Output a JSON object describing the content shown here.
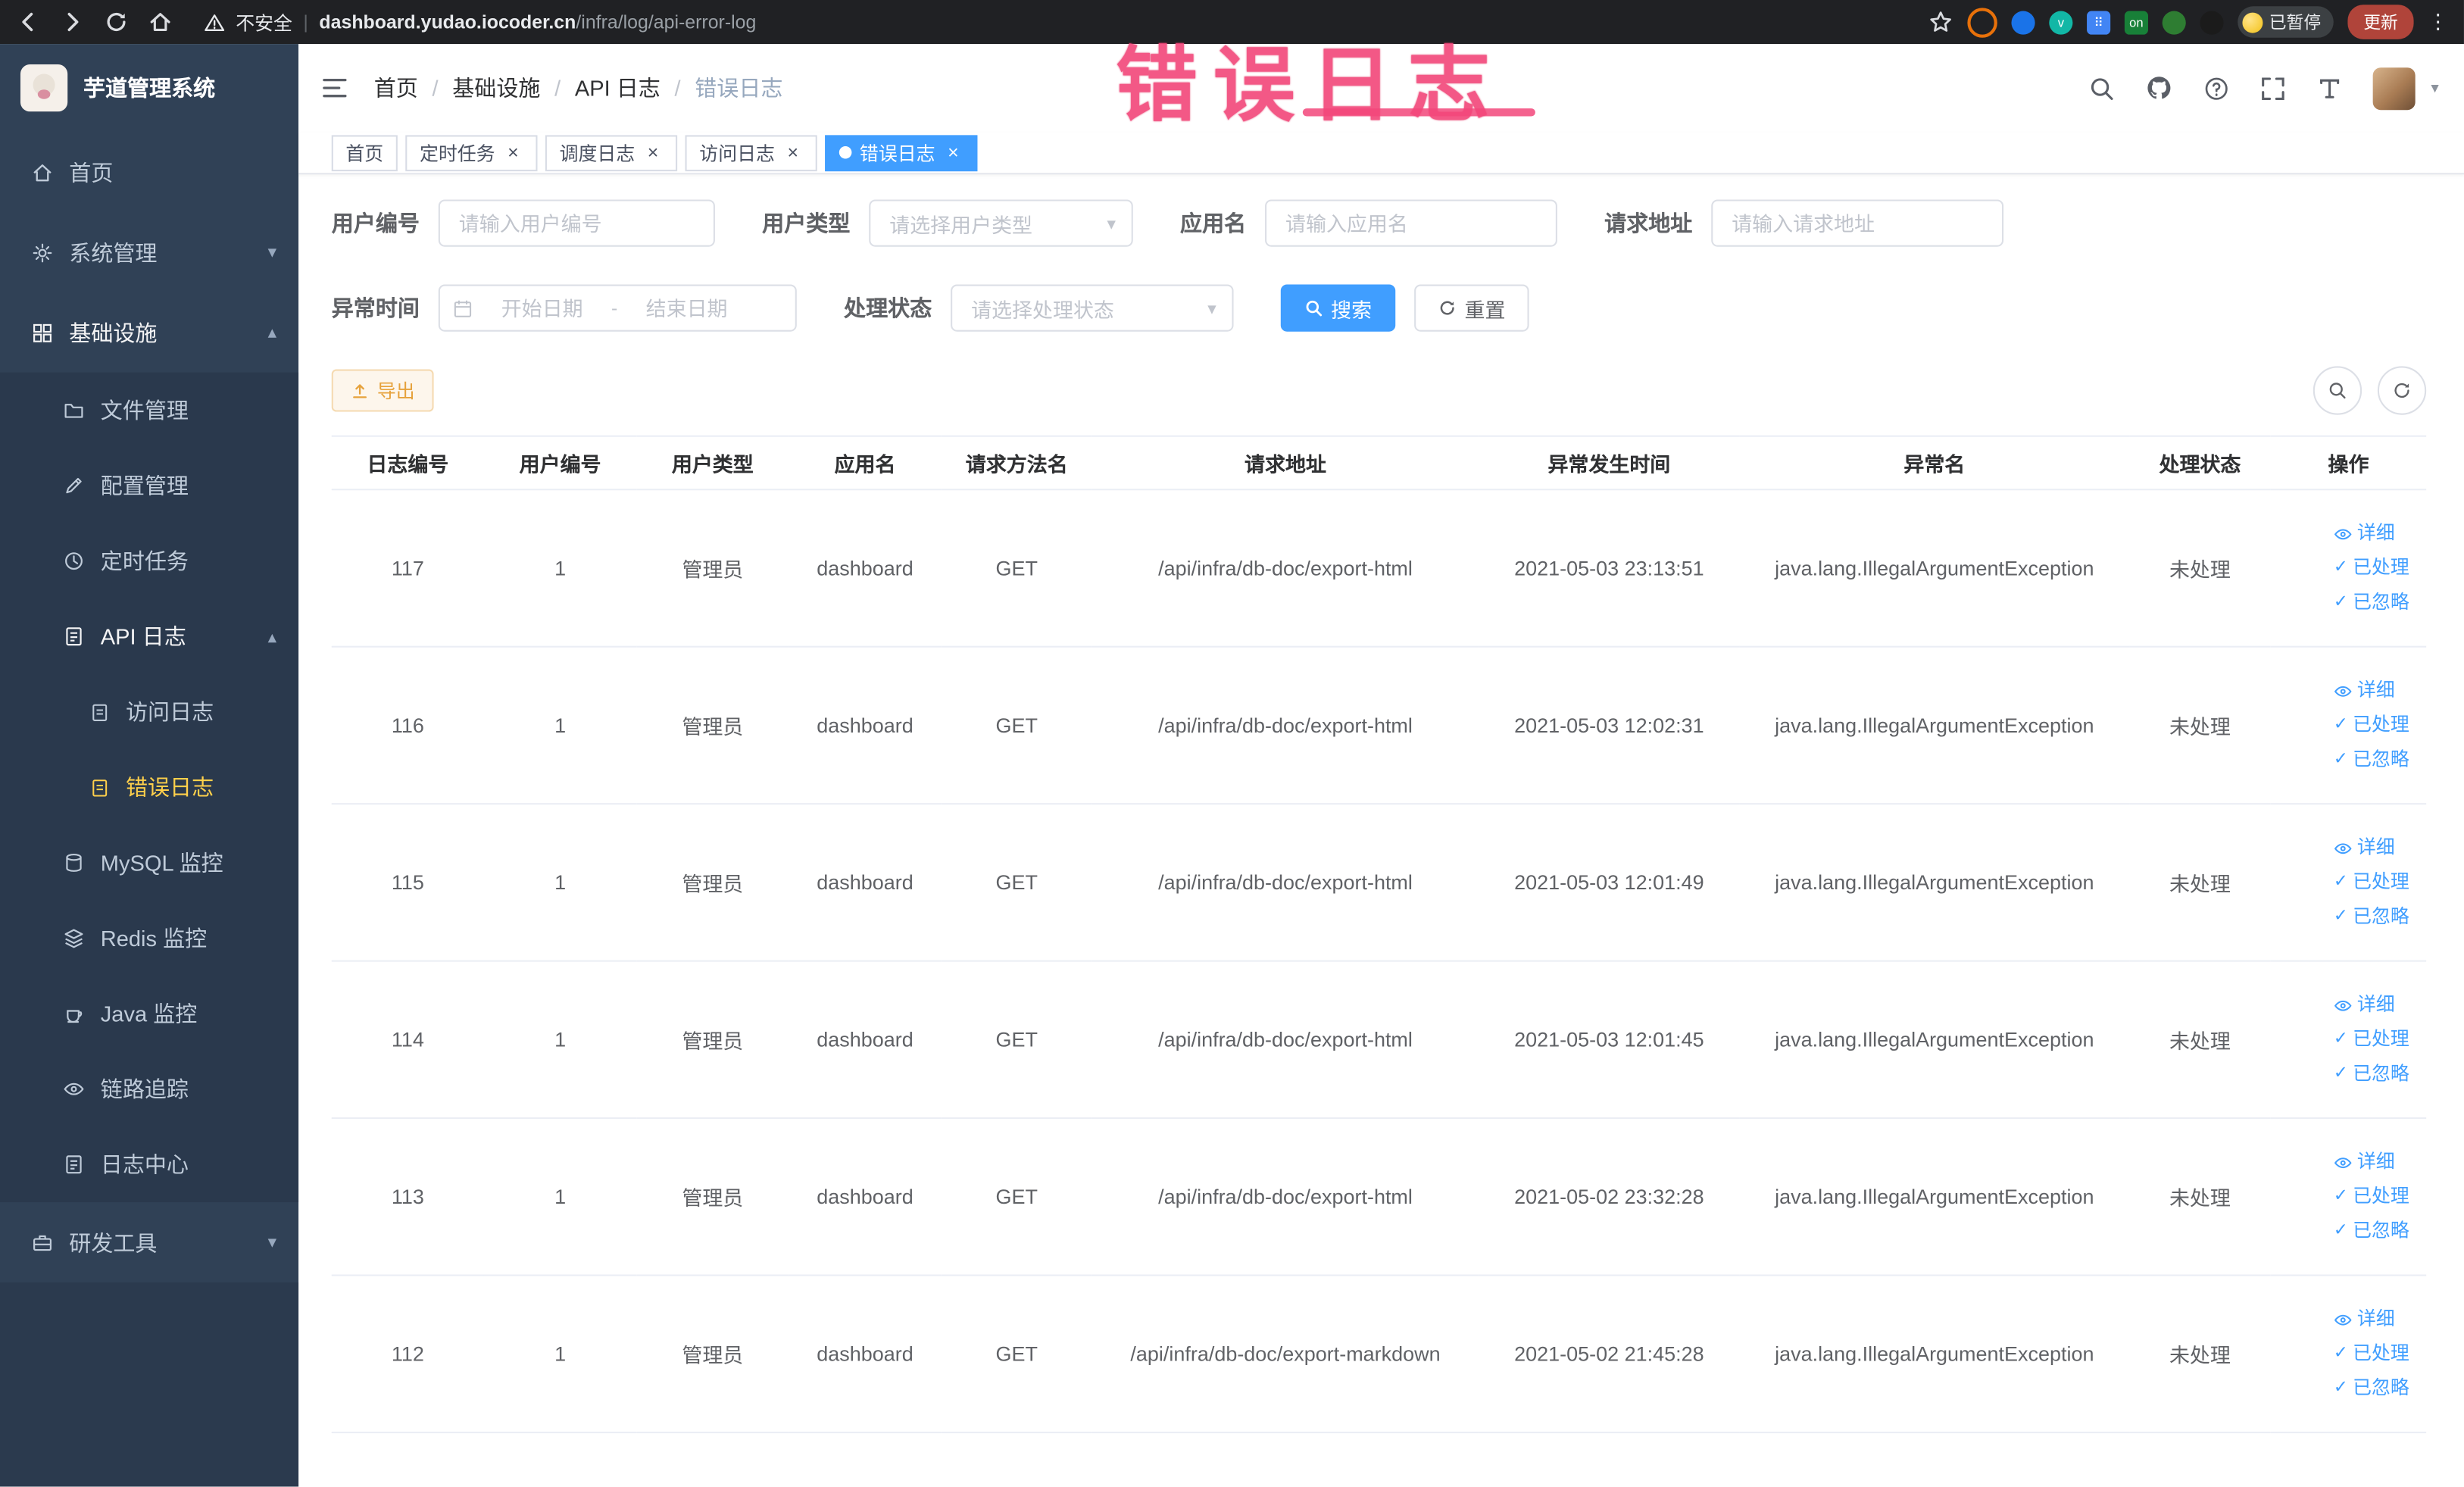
{
  "colors": {
    "primary": "#409eff",
    "sidebar_bg": "#304156",
    "active_menu_text": "#ffd04b",
    "warning": "#e6a23c",
    "annotation_pink": "#f2477a",
    "link_blue": "#409eff"
  },
  "icons": {
    "close": "×",
    "check": "✓",
    "kebab": "⋮",
    "caret_down": "▾",
    "caret_up": "▴",
    "question": "?",
    "breadcrumb_sep": "/",
    "range_sep": "-"
  },
  "browser": {
    "security_label": "不安全",
    "url_domain": "dashboard.yudao.iocoder.cn",
    "url_path": "/infra/log/api-error-log",
    "extension_on_label": "on",
    "paused_label": "已暂停",
    "update_label": "更新"
  },
  "sidebar": {
    "title": "芋道管理系统",
    "items": {
      "home": "首页",
      "system": "系统管理",
      "infra": "基础设施",
      "file": "文件管理",
      "config": "配置管理",
      "job": "定时任务",
      "api_log": "API 日志",
      "access_log": "访问日志",
      "error_log": "错误日志",
      "mysql": "MySQL 监控",
      "redis": "Redis 监控",
      "java": "Java 监控",
      "trace": "链路追踪",
      "log_center": "日志中心",
      "dev_tools": "研发工具"
    }
  },
  "navbar": {
    "breadcrumbs": [
      "首页",
      "基础设施",
      "API 日志",
      "错误日志"
    ]
  },
  "annotation": {
    "text": "错误日志"
  },
  "tabs": [
    {
      "label": "首页"
    },
    {
      "label": "定时任务"
    },
    {
      "label": "调度日志"
    },
    {
      "label": "访问日志"
    },
    {
      "label": "错误日志"
    }
  ],
  "filters": {
    "user_id_label": "用户编号",
    "user_id_placeholder": "请输入用户编号",
    "user_type_label": "用户类型",
    "user_type_placeholder": "请选择用户类型",
    "app_name_label": "应用名",
    "app_name_placeholder": "请输入应用名",
    "request_url_label": "请求地址",
    "request_url_placeholder": "请输入请求地址",
    "exception_time_label": "异常时间",
    "start_placeholder": "开始日期",
    "end_placeholder": "结束日期",
    "status_label": "处理状态",
    "status_placeholder": "请选择处理状态",
    "search_label": "搜索",
    "reset_label": "重置"
  },
  "toolbar": {
    "export_label": "导出"
  },
  "table": {
    "columns": [
      "日志编号",
      "用户编号",
      "用户类型",
      "应用名",
      "请求方法名",
      "请求地址",
      "异常发生时间",
      "异常名",
      "处理状态",
      "操作"
    ],
    "actions": {
      "detail": "详细",
      "processed": "已处理",
      "ignored": "已忽略"
    },
    "rows": [
      {
        "id": "117",
        "user_id": "1",
        "user_type": "管理员",
        "app": "dashboard",
        "method": "GET",
        "url": "/api/infra/db-doc/export-html",
        "time": "2021-05-03 23:13:51",
        "exception": "java.lang.IllegalArgumentException",
        "status": "未处理"
      },
      {
        "id": "116",
        "user_id": "1",
        "user_type": "管理员",
        "app": "dashboard",
        "method": "GET",
        "url": "/api/infra/db-doc/export-html",
        "time": "2021-05-03 12:02:31",
        "exception": "java.lang.IllegalArgumentException",
        "status": "未处理"
      },
      {
        "id": "115",
        "user_id": "1",
        "user_type": "管理员",
        "app": "dashboard",
        "method": "GET",
        "url": "/api/infra/db-doc/export-html",
        "time": "2021-05-03 12:01:49",
        "exception": "java.lang.IllegalArgumentException",
        "status": "未处理"
      },
      {
        "id": "114",
        "user_id": "1",
        "user_type": "管理员",
        "app": "dashboard",
        "method": "GET",
        "url": "/api/infra/db-doc/export-html",
        "time": "2021-05-03 12:01:45",
        "exception": "java.lang.IllegalArgumentException",
        "status": "未处理"
      },
      {
        "id": "113",
        "user_id": "1",
        "user_type": "管理员",
        "app": "dashboard",
        "method": "GET",
        "url": "/api/infra/db-doc/export-html",
        "time": "2021-05-02 23:32:28",
        "exception": "java.lang.IllegalArgumentException",
        "status": "未处理"
      },
      {
        "id": "112",
        "user_id": "1",
        "user_type": "管理员",
        "app": "dashboard",
        "method": "GET",
        "url": "/api/infra/db-doc/export-markdown",
        "time": "2021-05-02 21:45:28",
        "exception": "java.lang.IllegalArgumentException",
        "status": "未处理"
      }
    ]
  }
}
